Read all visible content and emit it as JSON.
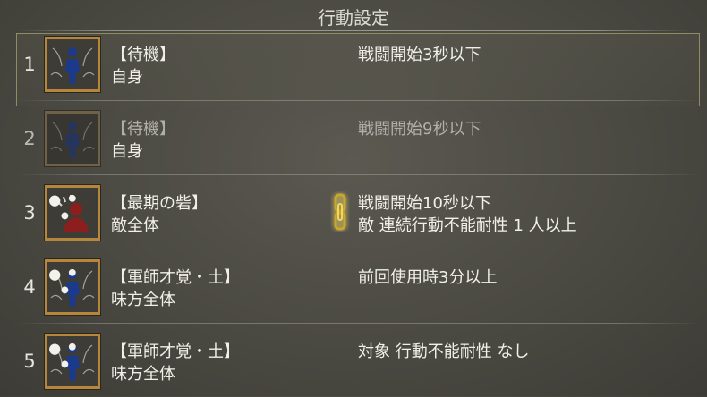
{
  "header": {
    "title": "行動設定"
  },
  "rows": [
    {
      "number": "1",
      "skill": "【待機】",
      "target": "自身",
      "conditions": [
        "戦闘開始3秒以下"
      ],
      "selected": true,
      "dimmed": false,
      "icon": "standing-figure-icon"
    },
    {
      "number": "2",
      "skill": "【待機】",
      "target": "自身",
      "conditions": [
        "戦闘開始9秒以下"
      ],
      "selected": false,
      "dimmed": true,
      "icon": "standing-figure-icon"
    },
    {
      "number": "3",
      "skill": "【最期の砦】",
      "target": "敵全体",
      "conditions": [
        "戦闘開始10秒以下",
        "敵 連続行動不能耐性 1 人以上"
      ],
      "selected": false,
      "dimmed": false,
      "icon": "red-figure-icon",
      "linked": true
    },
    {
      "number": "4",
      "skill": "【軍師才覚・土】",
      "target": "味方全体",
      "conditions": [
        "前回使用時3分以上"
      ],
      "selected": false,
      "dimmed": false,
      "icon": "standing-figure-icon"
    },
    {
      "number": "5",
      "skill": "【軍師才覚・土】",
      "target": "味方全体",
      "conditions": [
        "対象 行動不能耐性 なし"
      ],
      "selected": false,
      "dimmed": false,
      "icon": "standing-figure-icon"
    }
  ],
  "colors": {
    "frame": "#b6873a",
    "highlight": "#8d8c62",
    "chain": "#e6c84a",
    "figure": "#1c3a8c",
    "figure_red": "#8c1e1e"
  }
}
